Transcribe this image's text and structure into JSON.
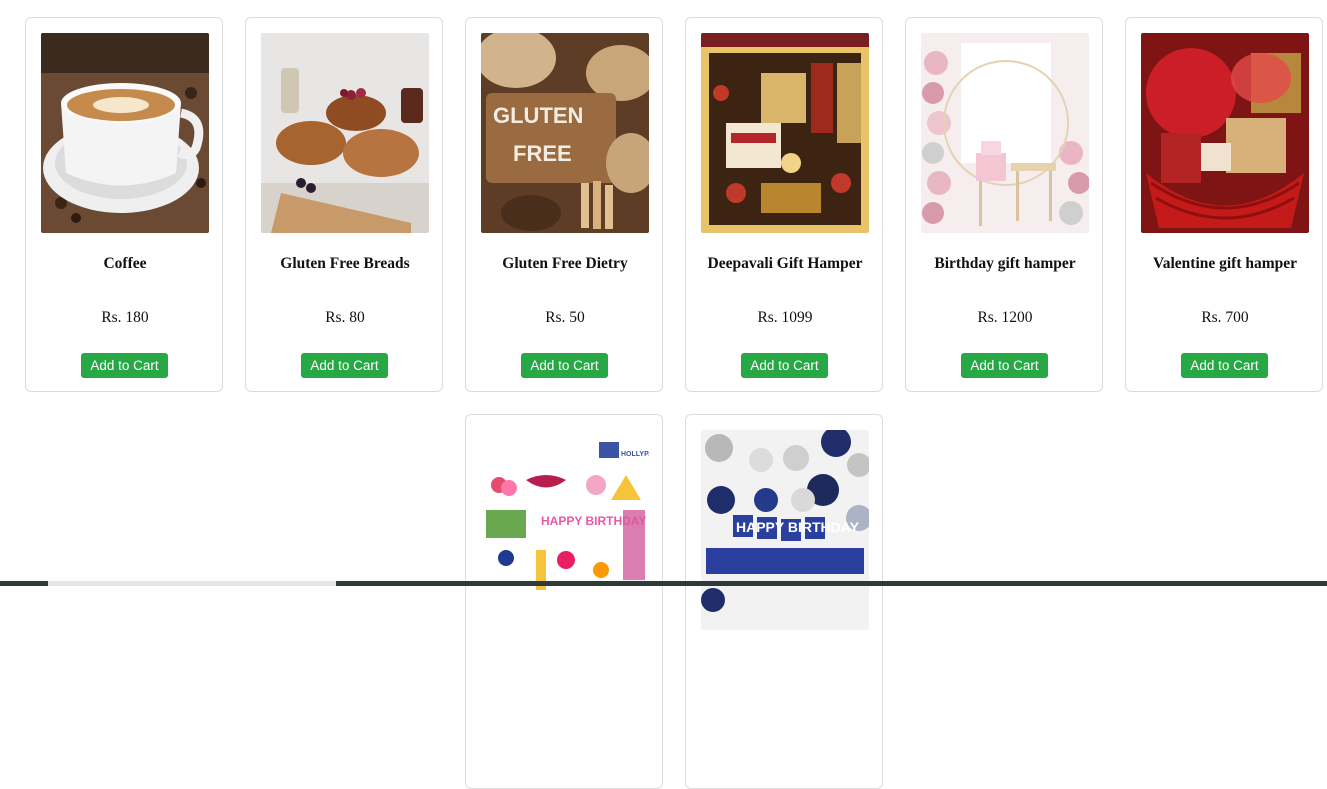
{
  "products": [
    {
      "name": "Coffee",
      "price": "Rs. 180",
      "cta": "Add to Cart",
      "icon": "coffee-cup-image"
    },
    {
      "name": "Gluten Free Breads",
      "price": "Rs. 80",
      "cta": "Add to Cart",
      "icon": "bread-loaves-image"
    },
    {
      "name": "Gluten Free Dietry",
      "price": "Rs. 50",
      "cta": "Add to Cart",
      "icon": "gluten-free-board-image"
    },
    {
      "name": "Deepavali Gift Hamper",
      "price": "Rs. 1099",
      "cta": "Add to Cart",
      "icon": "deepavali-hamper-image"
    },
    {
      "name": "Birthday gift hamper",
      "price": "Rs. 1200",
      "cta": "Add to Cart",
      "icon": "birthday-decor-image"
    },
    {
      "name": "Valentine gift hamper",
      "price": "Rs. 700",
      "cta": "Add to Cart",
      "icon": "valentine-basket-image"
    },
    {
      "name": "",
      "price": "",
      "cta": "",
      "icon": "party-kit-image",
      "text_in_image": "HAPPY BIRTHDAY"
    },
    {
      "name": "",
      "price": "",
      "cta": "",
      "icon": "blue-balloons-image",
      "text_in_image": "HAPPY BIRTHDAY"
    }
  ],
  "colors": {
    "button": "#28a745",
    "card_border": "#dcdcdc"
  }
}
